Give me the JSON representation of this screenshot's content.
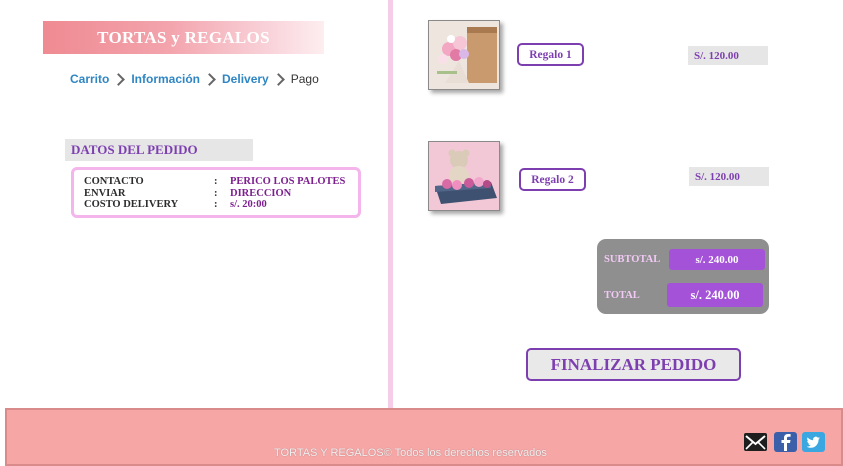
{
  "brand": {
    "title": "TORTAS y REGALOS"
  },
  "breadcrumb": [
    {
      "label": "Carrito"
    },
    {
      "label": "Información"
    },
    {
      "label": "Delivery"
    },
    {
      "label": "Pago"
    }
  ],
  "pedido": {
    "title": "DATOS DEL PEDIDO",
    "rows": [
      {
        "key": "CONTACTO",
        "sep": ":",
        "value": "PERICO LOS PALOTES"
      },
      {
        "key": "ENVIAR",
        "sep": ":",
        "value": "DIRECCION"
      },
      {
        "key": "COSTO DELIVERY",
        "sep": ":",
        "value": "s/. 20:00"
      }
    ]
  },
  "products": [
    {
      "name": "Regalo 1",
      "price": "S/. 120.00",
      "image": "flower-bouquet-box"
    },
    {
      "name": "Regalo 2",
      "price": "S/. 120.00",
      "image": "teddy-bear-flower-box"
    }
  ],
  "totals": {
    "subtotal_label": "SUBTOTAL",
    "subtotal_value": "s/. 240.00",
    "total_label": "TOTAL",
    "total_value": "s/. 240.00"
  },
  "actions": {
    "finalize_label": "FINALIZAR PEDIDO"
  },
  "footer": {
    "text": "TORTAS Y REGALOS© Todos los derechos reservados",
    "social": [
      "mail-icon",
      "facebook-icon",
      "twitter-icon"
    ]
  },
  "colors": {
    "accent_purple": "#7d3fb0",
    "banner_pink": "#ef8a92",
    "footer_pink": "#f7a6a6",
    "total_purple": "#a453d8",
    "link_blue": "#2f86c4"
  }
}
